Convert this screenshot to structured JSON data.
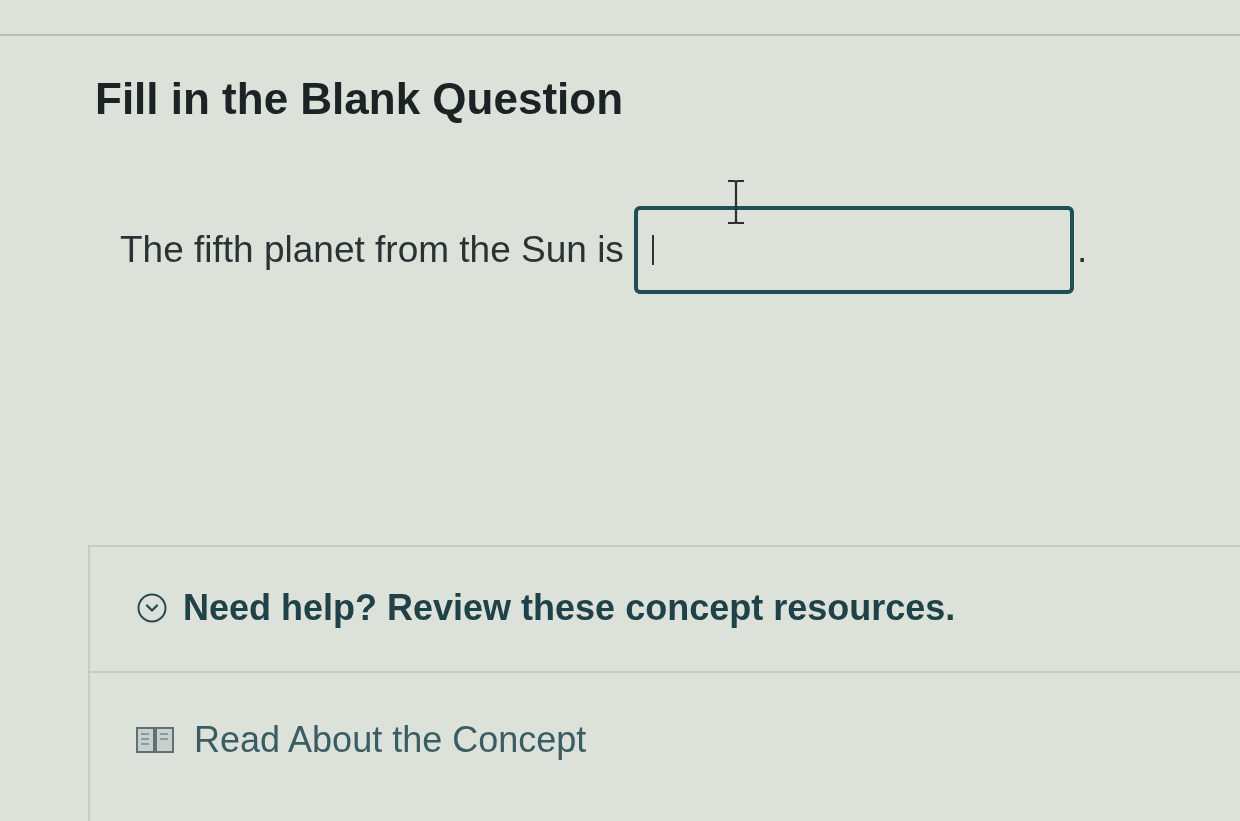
{
  "page_title": "Fill in the Blank Question",
  "question": {
    "prompt": "The fifth planet from the Sun is",
    "answer_field": {
      "focused": true
    },
    "end_mark": "."
  },
  "help": {
    "title": "Need help? Review these concept resources.",
    "expanded": true,
    "resources": [
      {
        "label": "Read About the Concept"
      }
    ]
  }
}
